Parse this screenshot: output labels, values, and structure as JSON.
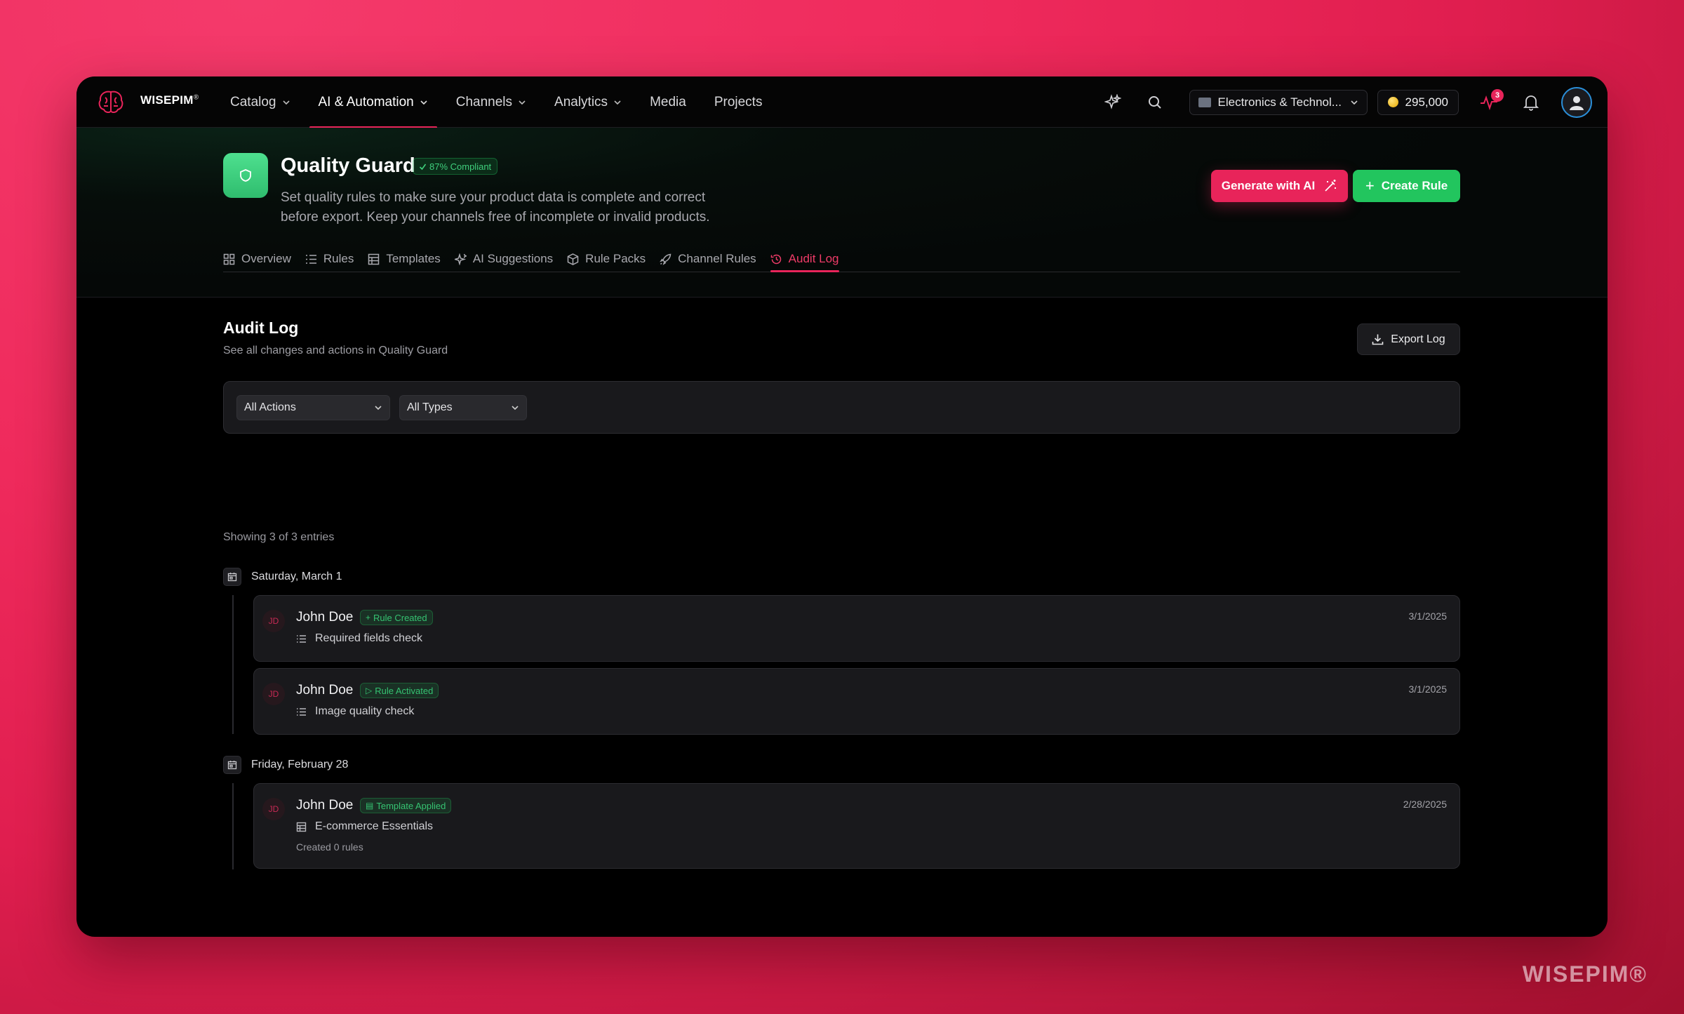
{
  "nav": {
    "brand": "WISEPIM",
    "brand_mark": "®",
    "items": [
      {
        "label": "Catalog",
        "dropdown": true
      },
      {
        "label": "AI & Automation",
        "dropdown": true,
        "active": true
      },
      {
        "label": "Channels",
        "dropdown": true
      },
      {
        "label": "Analytics",
        "dropdown": true
      },
      {
        "label": "Media",
        "dropdown": false
      },
      {
        "label": "Projects",
        "dropdown": false
      }
    ],
    "workspace": "Electronics & Technol...",
    "credits": "295,000",
    "activity_count": "3"
  },
  "header": {
    "title": "Quality Guard",
    "compliance": "87% Compliant",
    "description": "Set quality rules to make sure your product data is complete and correct before export. Keep your channels free of incomplete or invalid products.",
    "generate_label": "Generate with AI",
    "create_label": "Create Rule",
    "tabs": [
      {
        "label": "Overview",
        "icon": "grid-icon"
      },
      {
        "label": "Rules",
        "icon": "list-icon"
      },
      {
        "label": "Templates",
        "icon": "template-icon"
      },
      {
        "label": "AI Suggestions",
        "icon": "sparkle-icon"
      },
      {
        "label": "Rule Packs",
        "icon": "package-icon"
      },
      {
        "label": "Channel Rules",
        "icon": "rocket-icon"
      },
      {
        "label": "Audit Log",
        "icon": "history-icon",
        "active": true
      }
    ]
  },
  "audit": {
    "title": "Audit Log",
    "subtitle": "See all changes and actions in Quality Guard",
    "export_label": "Export Log",
    "filter_actions": "All Actions",
    "filter_types": "All Types",
    "showing": "Showing 3 of 3 entries",
    "groups": [
      {
        "date": "Saturday, March 1",
        "entries": [
          {
            "initials": "JD",
            "user": "John Doe",
            "action": "Rule Created",
            "action_glyph": "+",
            "item": "Required fields check",
            "item_icon": "list-icon",
            "note": "",
            "date": "3/1/2025"
          },
          {
            "initials": "JD",
            "user": "John Doe",
            "action": "Rule Activated",
            "action_glyph": "▷",
            "item": "Image quality check",
            "item_icon": "list-icon",
            "note": "",
            "date": "3/1/2025"
          }
        ]
      },
      {
        "date": "Friday, February 28",
        "entries": [
          {
            "initials": "JD",
            "user": "John Doe",
            "action": "Template Applied",
            "action_glyph": "▤",
            "item": "E-commerce Essentials",
            "item_icon": "template-icon",
            "note": "Created 0 rules",
            "date": "2/28/2025"
          }
        ]
      }
    ]
  },
  "watermark": "WISEPIM®",
  "colors": {
    "accent": "#e8245a",
    "success": "#22c55e",
    "background": "#000000"
  }
}
